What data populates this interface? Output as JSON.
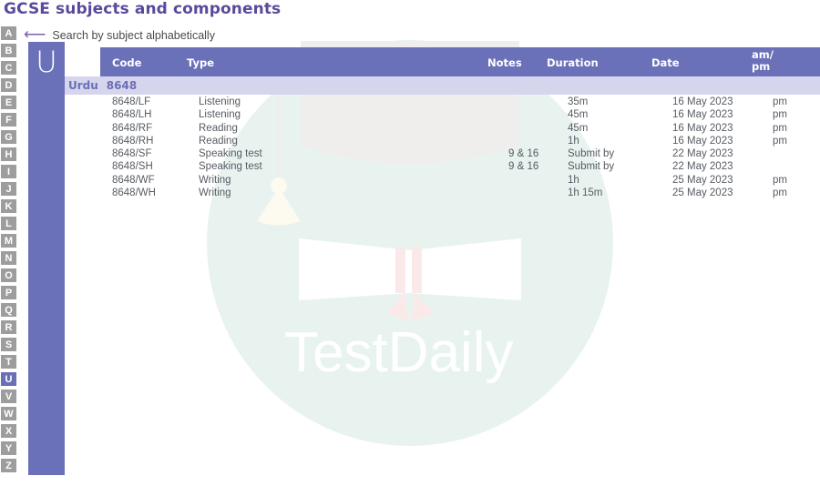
{
  "page_title": "GCSE subjects and components",
  "search_hint": {
    "arrow_icon": "left-arrow-icon",
    "label": "Search by subject alphabetically"
  },
  "alphabet": {
    "letters": [
      "A",
      "B",
      "C",
      "D",
      "E",
      "F",
      "G",
      "H",
      "I",
      "J",
      "K",
      "L",
      "M",
      "N",
      "O",
      "P",
      "Q",
      "R",
      "S",
      "T",
      "U",
      "V",
      "W",
      "X",
      "Y",
      "Z"
    ],
    "active": "U"
  },
  "letter_panel": {
    "letter": "U"
  },
  "table": {
    "headers": {
      "code": "Code",
      "type": "Type",
      "notes": "Notes",
      "duration": "Duration",
      "date": "Date",
      "ampm_line1": "am/",
      "ampm_line2": "pm"
    },
    "subject": {
      "name": "Urdu",
      "code": "8648"
    },
    "rows": [
      {
        "code": "8648/LF",
        "type": "Listening",
        "notes": "",
        "duration": "35m",
        "date": "16 May 2023",
        "ampm": "pm"
      },
      {
        "code": "8648/LH",
        "type": "Listening",
        "notes": "",
        "duration": "45m",
        "date": "16 May 2023",
        "ampm": "pm"
      },
      {
        "code": "8648/RF",
        "type": "Reading",
        "notes": "",
        "duration": "45m",
        "date": "16 May 2023",
        "ampm": "pm"
      },
      {
        "code": "8648/RH",
        "type": "Reading",
        "notes": "",
        "duration": "1h",
        "date": "16 May 2023",
        "ampm": "pm"
      },
      {
        "code": "8648/SF",
        "type": "Speaking test",
        "notes": "9 & 16",
        "duration": "Submit by",
        "date": "22 May 2023",
        "ampm": ""
      },
      {
        "code": "8648/SH",
        "type": "Speaking test",
        "notes": "9 & 16",
        "duration": "Submit by",
        "date": "22 May 2023",
        "ampm": ""
      },
      {
        "code": "8648/WF",
        "type": "Writing",
        "notes": "",
        "duration": "1h",
        "date": "25 May 2023",
        "ampm": "pm"
      },
      {
        "code": "8648/WH",
        "type": "Writing",
        "notes": "",
        "duration": "1h 15m",
        "date": "25 May 2023",
        "ampm": "pm"
      }
    ]
  },
  "watermark": {
    "brand": "TestDaily",
    "icon": "graduation-cap-icon"
  },
  "colors": {
    "title_purple": "#5b4a9b",
    "header_purple": "#6b71b8",
    "band_lavender": "#d6d5ee",
    "rail_gray": "#9d9d9d",
    "watermark_teal": "#e7f2ef",
    "watermark_cap": "#efeeec",
    "watermark_tassel": "#fdfaee",
    "watermark_ribbon": "#fbeaea"
  }
}
